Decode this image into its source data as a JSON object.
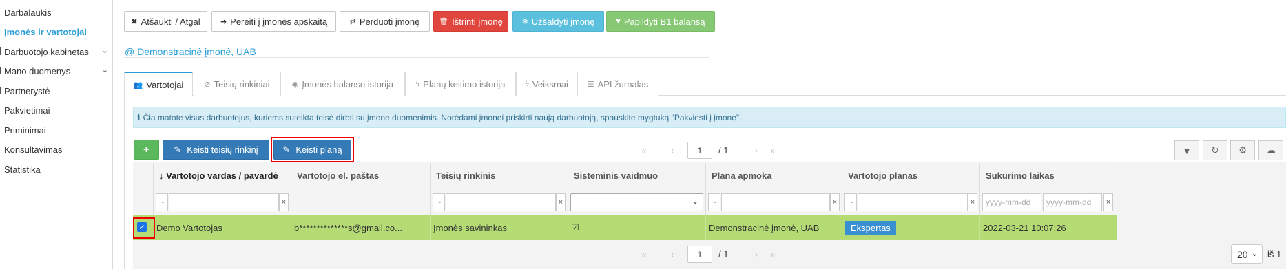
{
  "sidebar": {
    "items": [
      {
        "label": "Darbalaukis"
      },
      {
        "label": "Įmonės ir vartotojai"
      },
      {
        "label": "Darbuotojo kabinetas"
      },
      {
        "label": "Mano duomenys"
      },
      {
        "label": "Partnerystė"
      },
      {
        "label": "Pakvietimai"
      },
      {
        "label": "Priminimai"
      },
      {
        "label": "Konsultavimas"
      },
      {
        "label": "Statistika"
      }
    ]
  },
  "toolbar": {
    "back_label": "Atšaukti / Atgal",
    "goto_label": "Pereiti į įmonės apskaitą",
    "transfer_label": "Perduoti įmonę",
    "delete_label": "Ištrinti įmonę",
    "freeze_label": "Užšaldyti įmonę",
    "topup_label": "Papildyti B1 balansą"
  },
  "company": {
    "name": "@ Demonstracinė įmonė, UAB"
  },
  "tabs": [
    {
      "label": "Vartotojai"
    },
    {
      "label": "Teisių rinkiniai"
    },
    {
      "label": "Įmonės balanso istorija"
    },
    {
      "label": "Planų keitimo istorija"
    },
    {
      "label": "Veiksmai"
    },
    {
      "label": "API žurnalas"
    }
  ],
  "info": {
    "text": "Čia matote visus darbuotojus, kuriems suteikta teisė dirbti su įmone duomenimis. Norėdami įmonei priskirti naują darbuotoją, spauskite mygtuką \"Pakviesti į įmonę\"."
  },
  "grid_toolbar": {
    "add_label": "+",
    "change_rights_label": "Keisti teisių rinkinį",
    "change_plan_label": "Keisti planą"
  },
  "pager": {
    "current_page": "1",
    "total": "/ 1",
    "first": "«",
    "prev": "‹",
    "next": "›",
    "last": "»"
  },
  "grid": {
    "columns": [
      "Vartotojo vardas / pavardė",
      "Vartotojo el. paštas",
      "Teisių rinkinis",
      "Sisteminis vaidmuo",
      "Plana apmoka",
      "Vartotojo planas",
      "Sukūrimo laikas"
    ],
    "sort_indicator": "↓",
    "filters": {
      "tilde": "~",
      "clear": "×",
      "date_from_placeholder": "yyyy-mm-dd",
      "date_to_placeholder": "yyyy-mm-dd"
    },
    "rows": [
      {
        "name": "Demo Vartotojas",
        "email": "b**************s@gmail.co...",
        "rights": "Įmonės savininkas",
        "system_role": "☑",
        "payer": "Demonstracinė įmonė, UAB",
        "plan": "Ekspertas",
        "created": "2022-03-21 10:07:26"
      }
    ]
  },
  "footer": {
    "page_size": "20",
    "of_total": "iš 1"
  },
  "colors": {
    "accent": "#2a9fd6",
    "row_selected": "#b4db74",
    "highlight": "#ee0000"
  }
}
